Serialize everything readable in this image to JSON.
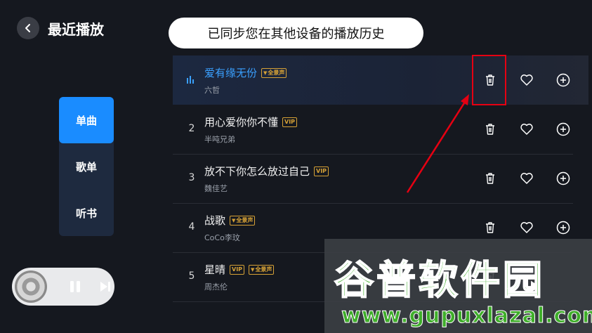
{
  "header": {
    "title": "最近播放",
    "sync_banner": "已同步您在其他设备的播放历史"
  },
  "sidebar": {
    "tabs": [
      {
        "label": "单曲",
        "active": true
      },
      {
        "label": "歌单",
        "active": false
      },
      {
        "label": "听书",
        "active": false
      }
    ]
  },
  "songs": [
    {
      "index": "",
      "title": "爱有缘无份",
      "artist": "六哲",
      "badges": [
        "全景声"
      ],
      "playing": true
    },
    {
      "index": "2",
      "title": "用心爱你你不懂",
      "artist": "半吨兄弟",
      "badges": [
        "VIP"
      ],
      "playing": false
    },
    {
      "index": "3",
      "title": "放不下你怎么放过自己",
      "artist": "魏佳艺",
      "badges": [
        "VIP"
      ],
      "playing": false
    },
    {
      "index": "4",
      "title": "战歌",
      "artist": "CoCo李玟",
      "badges": [
        "全景声"
      ],
      "playing": false
    },
    {
      "index": "5",
      "title": "星晴",
      "artist": "周杰伦",
      "badges": [
        "VIP",
        "全景声"
      ],
      "playing": false
    }
  ],
  "watermark": {
    "title": "谷普软件园",
    "url": "www.gupuxlazal.com"
  },
  "colors": {
    "background": "#15181f",
    "accent": "#1a8cff",
    "playing_title": "#3aa0ff",
    "badge": "#d6a136",
    "highlight": "#e60012",
    "watermark_green": "#3fae2a"
  },
  "icons": {
    "back": "chevron-left-icon",
    "delete": "trash-icon",
    "favorite": "heart-icon",
    "add": "plus-circle-icon",
    "playing": "equalizer-bars-icon",
    "pause": "pause-icon",
    "next": "skip-next-icon"
  }
}
